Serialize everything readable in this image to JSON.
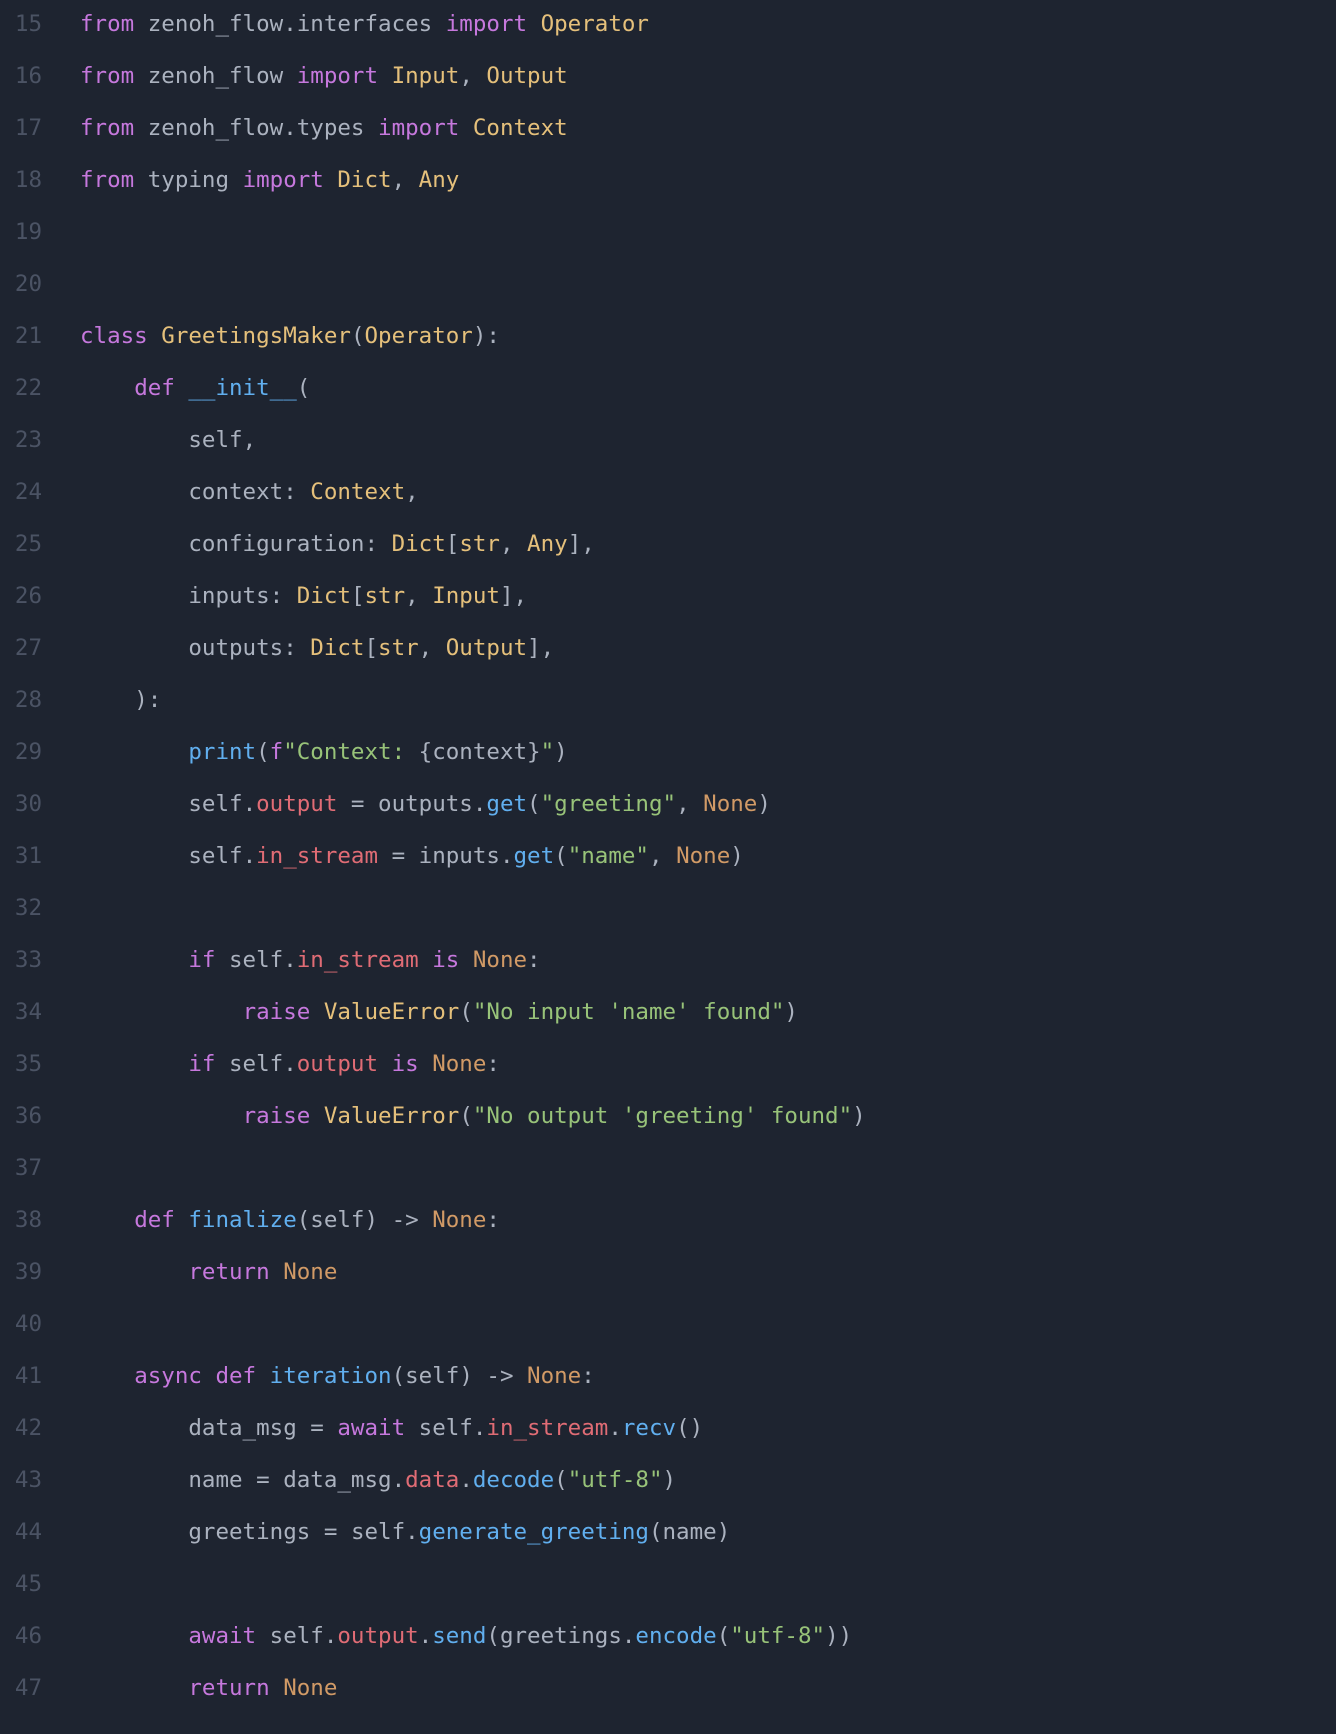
{
  "lines": [
    {
      "num": "15",
      "tokens": [
        {
          "t": "from ",
          "c": "kw"
        },
        {
          "t": "zenoh_flow",
          "c": "text"
        },
        {
          "t": ".",
          "c": "punct"
        },
        {
          "t": "interfaces ",
          "c": "text"
        },
        {
          "t": "import ",
          "c": "kw"
        },
        {
          "t": "Operator",
          "c": "cls"
        }
      ]
    },
    {
      "num": "16",
      "tokens": [
        {
          "t": "from ",
          "c": "kw"
        },
        {
          "t": "zenoh_flow ",
          "c": "text"
        },
        {
          "t": "import ",
          "c": "kw"
        },
        {
          "t": "Input",
          "c": "cls"
        },
        {
          "t": ", ",
          "c": "punct"
        },
        {
          "t": "Output",
          "c": "cls"
        }
      ]
    },
    {
      "num": "17",
      "tokens": [
        {
          "t": "from ",
          "c": "kw"
        },
        {
          "t": "zenoh_flow",
          "c": "text"
        },
        {
          "t": ".",
          "c": "punct"
        },
        {
          "t": "types ",
          "c": "text"
        },
        {
          "t": "import ",
          "c": "kw"
        },
        {
          "t": "Context",
          "c": "cls"
        }
      ]
    },
    {
      "num": "18",
      "tokens": [
        {
          "t": "from ",
          "c": "kw"
        },
        {
          "t": "typing ",
          "c": "text"
        },
        {
          "t": "import ",
          "c": "kw"
        },
        {
          "t": "Dict",
          "c": "cls"
        },
        {
          "t": ", ",
          "c": "punct"
        },
        {
          "t": "Any",
          "c": "cls"
        }
      ]
    },
    {
      "num": "19",
      "tokens": []
    },
    {
      "num": "20",
      "tokens": []
    },
    {
      "num": "21",
      "tokens": [
        {
          "t": "class ",
          "c": "kw"
        },
        {
          "t": "GreetingsMaker",
          "c": "cls"
        },
        {
          "t": "(",
          "c": "punct"
        },
        {
          "t": "Operator",
          "c": "cls"
        },
        {
          "t": "):",
          "c": "punct"
        }
      ]
    },
    {
      "num": "22",
      "tokens": [
        {
          "t": "    ",
          "c": "text"
        },
        {
          "t": "def ",
          "c": "kw"
        },
        {
          "t": "__init__",
          "c": "dunder"
        },
        {
          "t": "(",
          "c": "punct"
        }
      ]
    },
    {
      "num": "23",
      "tokens": [
        {
          "t": "        ",
          "c": "text"
        },
        {
          "t": "self",
          "c": "text"
        },
        {
          "t": ",",
          "c": "punct"
        }
      ]
    },
    {
      "num": "24",
      "tokens": [
        {
          "t": "        ",
          "c": "text"
        },
        {
          "t": "context",
          "c": "text"
        },
        {
          "t": ": ",
          "c": "punct"
        },
        {
          "t": "Context",
          "c": "cls"
        },
        {
          "t": ",",
          "c": "punct"
        }
      ]
    },
    {
      "num": "25",
      "tokens": [
        {
          "t": "        ",
          "c": "text"
        },
        {
          "t": "configuration",
          "c": "text"
        },
        {
          "t": ": ",
          "c": "punct"
        },
        {
          "t": "Dict",
          "c": "cls"
        },
        {
          "t": "[",
          "c": "punct"
        },
        {
          "t": "str",
          "c": "cls"
        },
        {
          "t": ", ",
          "c": "punct"
        },
        {
          "t": "Any",
          "c": "cls"
        },
        {
          "t": "],",
          "c": "punct"
        }
      ]
    },
    {
      "num": "26",
      "tokens": [
        {
          "t": "        ",
          "c": "text"
        },
        {
          "t": "inputs",
          "c": "text"
        },
        {
          "t": ": ",
          "c": "punct"
        },
        {
          "t": "Dict",
          "c": "cls"
        },
        {
          "t": "[",
          "c": "punct"
        },
        {
          "t": "str",
          "c": "cls"
        },
        {
          "t": ", ",
          "c": "punct"
        },
        {
          "t": "Input",
          "c": "cls"
        },
        {
          "t": "],",
          "c": "punct"
        }
      ]
    },
    {
      "num": "27",
      "tokens": [
        {
          "t": "        ",
          "c": "text"
        },
        {
          "t": "outputs",
          "c": "text"
        },
        {
          "t": ": ",
          "c": "punct"
        },
        {
          "t": "Dict",
          "c": "cls"
        },
        {
          "t": "[",
          "c": "punct"
        },
        {
          "t": "str",
          "c": "cls"
        },
        {
          "t": ", ",
          "c": "punct"
        },
        {
          "t": "Output",
          "c": "cls"
        },
        {
          "t": "],",
          "c": "punct"
        }
      ]
    },
    {
      "num": "28",
      "tokens": [
        {
          "t": "    ",
          "c": "text"
        },
        {
          "t": "):",
          "c": "punct"
        }
      ]
    },
    {
      "num": "29",
      "tokens": [
        {
          "t": "        ",
          "c": "text"
        },
        {
          "t": "print",
          "c": "builtin"
        },
        {
          "t": "(",
          "c": "punct"
        },
        {
          "t": "f",
          "c": "kw"
        },
        {
          "t": "\"Context: ",
          "c": "str"
        },
        {
          "t": "{context}",
          "c": "text"
        },
        {
          "t": "\"",
          "c": "str"
        },
        {
          "t": ")",
          "c": "punct"
        }
      ]
    },
    {
      "num": "30",
      "tokens": [
        {
          "t": "        ",
          "c": "text"
        },
        {
          "t": "self",
          "c": "text"
        },
        {
          "t": ".",
          "c": "punct"
        },
        {
          "t": "output",
          "c": "prop"
        },
        {
          "t": " = ",
          "c": "text"
        },
        {
          "t": "outputs",
          "c": "text"
        },
        {
          "t": ".",
          "c": "punct"
        },
        {
          "t": "get",
          "c": "fn"
        },
        {
          "t": "(",
          "c": "punct"
        },
        {
          "t": "\"greeting\"",
          "c": "str"
        },
        {
          "t": ", ",
          "c": "punct"
        },
        {
          "t": "None",
          "c": "none"
        },
        {
          "t": ")",
          "c": "punct"
        }
      ]
    },
    {
      "num": "31",
      "tokens": [
        {
          "t": "        ",
          "c": "text"
        },
        {
          "t": "self",
          "c": "text"
        },
        {
          "t": ".",
          "c": "punct"
        },
        {
          "t": "in_stream",
          "c": "prop"
        },
        {
          "t": " = ",
          "c": "text"
        },
        {
          "t": "inputs",
          "c": "text"
        },
        {
          "t": ".",
          "c": "punct"
        },
        {
          "t": "get",
          "c": "fn"
        },
        {
          "t": "(",
          "c": "punct"
        },
        {
          "t": "\"name\"",
          "c": "str"
        },
        {
          "t": ", ",
          "c": "punct"
        },
        {
          "t": "None",
          "c": "none"
        },
        {
          "t": ")",
          "c": "punct"
        }
      ]
    },
    {
      "num": "32",
      "tokens": []
    },
    {
      "num": "33",
      "tokens": [
        {
          "t": "        ",
          "c": "text"
        },
        {
          "t": "if ",
          "c": "kw"
        },
        {
          "t": "self",
          "c": "text"
        },
        {
          "t": ".",
          "c": "punct"
        },
        {
          "t": "in_stream",
          "c": "prop"
        },
        {
          "t": " ",
          "c": "text"
        },
        {
          "t": "is ",
          "c": "kw"
        },
        {
          "t": "None",
          "c": "none"
        },
        {
          "t": ":",
          "c": "punct"
        }
      ]
    },
    {
      "num": "34",
      "tokens": [
        {
          "t": "            ",
          "c": "text"
        },
        {
          "t": "raise ",
          "c": "kw"
        },
        {
          "t": "ValueError",
          "c": "cls"
        },
        {
          "t": "(",
          "c": "punct"
        },
        {
          "t": "\"No input 'name' found\"",
          "c": "str"
        },
        {
          "t": ")",
          "c": "punct"
        }
      ]
    },
    {
      "num": "35",
      "tokens": [
        {
          "t": "        ",
          "c": "text"
        },
        {
          "t": "if ",
          "c": "kw"
        },
        {
          "t": "self",
          "c": "text"
        },
        {
          "t": ".",
          "c": "punct"
        },
        {
          "t": "output",
          "c": "prop"
        },
        {
          "t": " ",
          "c": "text"
        },
        {
          "t": "is ",
          "c": "kw"
        },
        {
          "t": "None",
          "c": "none"
        },
        {
          "t": ":",
          "c": "punct"
        }
      ]
    },
    {
      "num": "36",
      "tokens": [
        {
          "t": "            ",
          "c": "text"
        },
        {
          "t": "raise ",
          "c": "kw"
        },
        {
          "t": "ValueError",
          "c": "cls"
        },
        {
          "t": "(",
          "c": "punct"
        },
        {
          "t": "\"No output 'greeting' found\"",
          "c": "str"
        },
        {
          "t": ")",
          "c": "punct"
        }
      ]
    },
    {
      "num": "37",
      "tokens": []
    },
    {
      "num": "38",
      "tokens": [
        {
          "t": "    ",
          "c": "text"
        },
        {
          "t": "def ",
          "c": "kw"
        },
        {
          "t": "finalize",
          "c": "fn"
        },
        {
          "t": "(",
          "c": "punct"
        },
        {
          "t": "self",
          "c": "text"
        },
        {
          "t": ") ",
          "c": "punct"
        },
        {
          "t": "-> ",
          "c": "arrow"
        },
        {
          "t": "None",
          "c": "none"
        },
        {
          "t": ":",
          "c": "punct"
        }
      ]
    },
    {
      "num": "39",
      "tokens": [
        {
          "t": "        ",
          "c": "text"
        },
        {
          "t": "return ",
          "c": "kw"
        },
        {
          "t": "None",
          "c": "none"
        }
      ]
    },
    {
      "num": "40",
      "tokens": []
    },
    {
      "num": "41",
      "tokens": [
        {
          "t": "    ",
          "c": "text"
        },
        {
          "t": "async ",
          "c": "kw"
        },
        {
          "t": "def ",
          "c": "kw"
        },
        {
          "t": "iteration",
          "c": "fn"
        },
        {
          "t": "(",
          "c": "punct"
        },
        {
          "t": "self",
          "c": "text"
        },
        {
          "t": ") ",
          "c": "punct"
        },
        {
          "t": "-> ",
          "c": "arrow"
        },
        {
          "t": "None",
          "c": "none"
        },
        {
          "t": ":",
          "c": "punct"
        }
      ]
    },
    {
      "num": "42",
      "tokens": [
        {
          "t": "        ",
          "c": "text"
        },
        {
          "t": "data_msg",
          "c": "text"
        },
        {
          "t": " = ",
          "c": "text"
        },
        {
          "t": "await ",
          "c": "kw"
        },
        {
          "t": "self",
          "c": "text"
        },
        {
          "t": ".",
          "c": "punct"
        },
        {
          "t": "in_stream",
          "c": "prop"
        },
        {
          "t": ".",
          "c": "punct"
        },
        {
          "t": "recv",
          "c": "fn"
        },
        {
          "t": "()",
          "c": "punct"
        }
      ]
    },
    {
      "num": "43",
      "tokens": [
        {
          "t": "        ",
          "c": "text"
        },
        {
          "t": "name",
          "c": "text"
        },
        {
          "t": " = ",
          "c": "text"
        },
        {
          "t": "data_msg",
          "c": "text"
        },
        {
          "t": ".",
          "c": "punct"
        },
        {
          "t": "data",
          "c": "prop"
        },
        {
          "t": ".",
          "c": "punct"
        },
        {
          "t": "decode",
          "c": "fn"
        },
        {
          "t": "(",
          "c": "punct"
        },
        {
          "t": "\"utf-8\"",
          "c": "str"
        },
        {
          "t": ")",
          "c": "punct"
        }
      ]
    },
    {
      "num": "44",
      "tokens": [
        {
          "t": "        ",
          "c": "text"
        },
        {
          "t": "greetings",
          "c": "text"
        },
        {
          "t": " = ",
          "c": "text"
        },
        {
          "t": "self",
          "c": "text"
        },
        {
          "t": ".",
          "c": "punct"
        },
        {
          "t": "generate_greeting",
          "c": "fn"
        },
        {
          "t": "(",
          "c": "punct"
        },
        {
          "t": "name",
          "c": "text"
        },
        {
          "t": ")",
          "c": "punct"
        }
      ]
    },
    {
      "num": "45",
      "tokens": []
    },
    {
      "num": "46",
      "tokens": [
        {
          "t": "        ",
          "c": "text"
        },
        {
          "t": "await ",
          "c": "kw"
        },
        {
          "t": "self",
          "c": "text"
        },
        {
          "t": ".",
          "c": "punct"
        },
        {
          "t": "output",
          "c": "prop"
        },
        {
          "t": ".",
          "c": "punct"
        },
        {
          "t": "send",
          "c": "fn"
        },
        {
          "t": "(",
          "c": "punct"
        },
        {
          "t": "greetings",
          "c": "text"
        },
        {
          "t": ".",
          "c": "punct"
        },
        {
          "t": "encode",
          "c": "fn"
        },
        {
          "t": "(",
          "c": "punct"
        },
        {
          "t": "\"utf-8\"",
          "c": "str"
        },
        {
          "t": "))",
          "c": "punct"
        }
      ]
    },
    {
      "num": "47",
      "tokens": [
        {
          "t": "        ",
          "c": "text"
        },
        {
          "t": "return ",
          "c": "kw"
        },
        {
          "t": "None",
          "c": "none"
        }
      ]
    }
  ]
}
